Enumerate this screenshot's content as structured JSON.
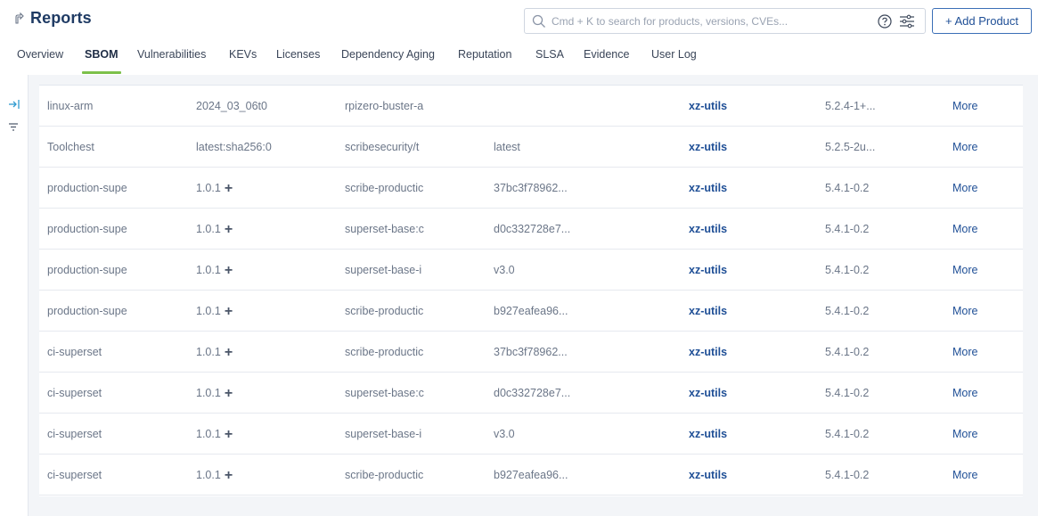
{
  "header": {
    "title": "Reports",
    "search_placeholder": "Cmd + K to search for products, versions, CVEs...",
    "add_product_label": "+ Add Product"
  },
  "tabs": [
    {
      "label": "Overview"
    },
    {
      "label": "SBOM"
    },
    {
      "label": "Vulnerabilities"
    },
    {
      "label": "KEVs"
    },
    {
      "label": "Licenses"
    },
    {
      "label": "Dependency Aging"
    },
    {
      "label": "Reputation"
    },
    {
      "label": "SLSA"
    },
    {
      "label": "Evidence"
    },
    {
      "label": "User Log"
    }
  ],
  "active_tab": "SBOM",
  "colors": {
    "accent_underline": "#7cc04a",
    "link_blue": "#1f4f96",
    "title_navy": "#1f3b64"
  },
  "rows": [
    {
      "product": "linux-arm",
      "version": "2024_03_06t0",
      "target": "rpizero-buster-a",
      "tag": "",
      "package": "xz-utils",
      "pkg_version": "5.2.4-1+...",
      "action": "More",
      "has_plus": false
    },
    {
      "product": "Toolchest",
      "version": "latest:sha256:0",
      "target": "scribesecurity/t",
      "tag": "latest",
      "package": "xz-utils",
      "pkg_version": "5.2.5-2u...",
      "action": "More",
      "has_plus": false
    },
    {
      "product": "production-supe",
      "version": "1.0.1",
      "target": "scribe-productic",
      "tag": "37bc3f78962...",
      "package": "xz-utils",
      "pkg_version": "5.4.1-0.2",
      "action": "More",
      "has_plus": true
    },
    {
      "product": "production-supe",
      "version": "1.0.1",
      "target": "superset-base:c",
      "tag": "d0c332728e7...",
      "package": "xz-utils",
      "pkg_version": "5.4.1-0.2",
      "action": "More",
      "has_plus": true
    },
    {
      "product": "production-supe",
      "version": "1.0.1",
      "target": "superset-base-i",
      "tag": "v3.0",
      "package": "xz-utils",
      "pkg_version": "5.4.1-0.2",
      "action": "More",
      "has_plus": true
    },
    {
      "product": "production-supe",
      "version": "1.0.1",
      "target": "scribe-productic",
      "tag": "b927eafea96...",
      "package": "xz-utils",
      "pkg_version": "5.4.1-0.2",
      "action": "More",
      "has_plus": true
    },
    {
      "product": "ci-superset",
      "version": "1.0.1",
      "target": "scribe-productic",
      "tag": "37bc3f78962...",
      "package": "xz-utils",
      "pkg_version": "5.4.1-0.2",
      "action": "More",
      "has_plus": true
    },
    {
      "product": "ci-superset",
      "version": "1.0.1",
      "target": "superset-base:c",
      "tag": "d0c332728e7...",
      "package": "xz-utils",
      "pkg_version": "5.4.1-0.2",
      "action": "More",
      "has_plus": true
    },
    {
      "product": "ci-superset",
      "version": "1.0.1",
      "target": "superset-base-i",
      "tag": "v3.0",
      "package": "xz-utils",
      "pkg_version": "5.4.1-0.2",
      "action": "More",
      "has_plus": true
    },
    {
      "product": "ci-superset",
      "version": "1.0.1",
      "target": "scribe-productic",
      "tag": "b927eafea96...",
      "package": "xz-utils",
      "pkg_version": "5.4.1-0.2",
      "action": "More",
      "has_plus": true
    }
  ]
}
